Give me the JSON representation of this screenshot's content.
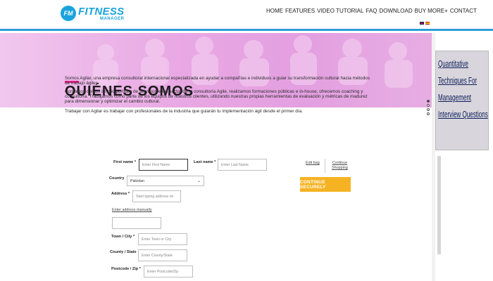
{
  "header": {
    "logo_mark": "FM",
    "logo_main": "FITNESS",
    "logo_sub": "MANAGER",
    "nav": [
      "HOME",
      "FEATURES",
      "VIDEO TUTORIAL",
      "FAQ",
      "DOWNLOAD",
      "BUY MORE+",
      "CONTACT"
    ]
  },
  "hero": {
    "title": "QUIÉNES SOMOS",
    "paragraph_1": "Somos Agilar, una empresa consultoral internacional especializada en ayudar a compañías e individuos a guiar su transformación cultural hacia métodos de trabajo ágiles.",
    "paragraph_2": "Contamos con un amplio portfolio de servicios en el sector de la consultoría Agile, realizamos formaciones públicas e in-house, ofrecemos coaching y consultoría. Trabajamos como parte de los equipos de nuestros clientes, utilizando nuestras propias herramientas de evaluación y métricas de madurez para dimensionar y optimizar el cambio cultural.",
    "paragraph_3": "Trabajar con Agilar es trabajar con profesionales de la industria que guiarán tu implementación ágil desde el primer día."
  },
  "ad": {
    "text": "Quantitative Techniques For Management Interview Questions"
  },
  "form": {
    "first_name_label": "First name *",
    "first_name_placeholder": "Enter First Name",
    "last_name_label": "Last name *",
    "last_name_placeholder": "Enter Last Name",
    "country_label": "Country",
    "country_value": "Pakistan",
    "address_label": "Address *",
    "address_placeholder": "Start typing address on",
    "address_manual_link": "Enter address manually",
    "town_label": "Town / City *",
    "town_placeholder": "Enter Town or City",
    "county_label": "County / State",
    "county_placeholder": "Enter County/State",
    "postcode_label": "Postcode / Zip *",
    "postcode_placeholder": "Enter Postcode/Zip"
  },
  "cart": {
    "edit_link": "Edit bag",
    "continue_shopping_line1": "Continue",
    "continue_shopping_line2": "Shopping",
    "continue_button": "CONTINUE SECURELY"
  },
  "colors": {
    "accent_blue": "#1aa3dc",
    "hero_pink": "#e39fe0",
    "accent_magenta": "#e91e8c",
    "button_orange": "#f5b324"
  }
}
